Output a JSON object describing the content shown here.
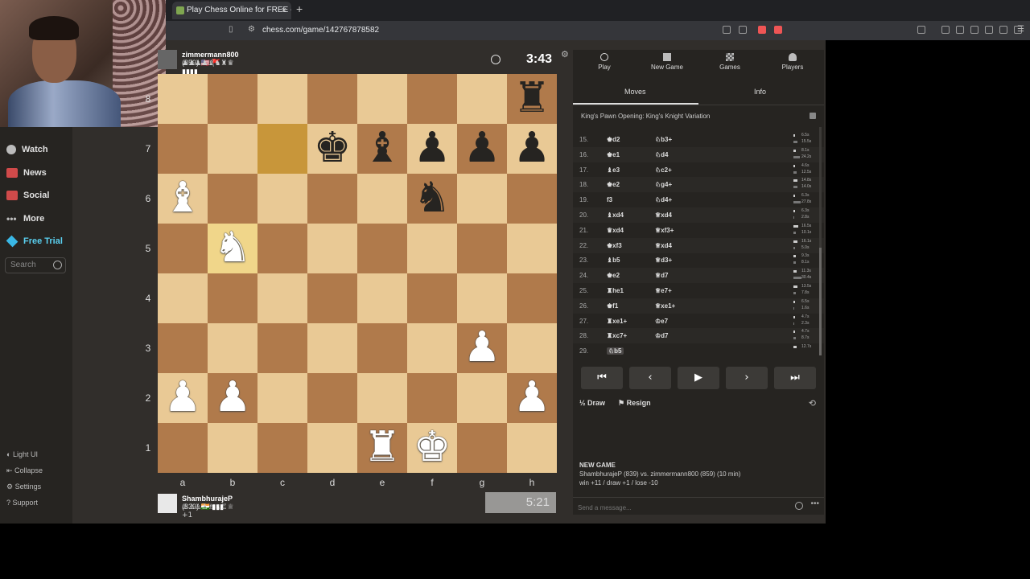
{
  "browser": {
    "tab_title": "Play Chess Online for FREE - ",
    "tab_close": "×",
    "new_tab": "+",
    "url": "chess.com/game/142767878582"
  },
  "sidebar": {
    "items": [
      {
        "label": "Watch",
        "icon": "watch-icon"
      },
      {
        "label": "News",
        "icon": "news-icon"
      },
      {
        "label": "Social",
        "icon": "social-icon"
      },
      {
        "label": "More",
        "icon": "more-icon"
      },
      {
        "label": "Free Trial",
        "icon": "diamond-icon"
      }
    ],
    "search_placeholder": "Search",
    "footer": [
      {
        "label": "Light UI",
        "icon": "light-icon"
      },
      {
        "label": "Collapse",
        "icon": "collapse-icon"
      },
      {
        "label": "Settings",
        "icon": "gear-icon"
      },
      {
        "label": "Support",
        "icon": "support-icon"
      }
    ]
  },
  "top_player": {
    "name": "zimmermann800",
    "rating": "(859)",
    "flags": "🇺🇸 🚩 ▮▮▮▮",
    "captured": "♟♟♟♟♝♞♜♛",
    "clock": "3:43"
  },
  "bottom_player": {
    "name": "ShambhurajeP",
    "rating": "(839)",
    "flags": "🇮🇳 ▮▮▮",
    "captured": "♙♙♙♙♗♘♖♕",
    "advantage": "+1",
    "clock": "5:21"
  },
  "board": {
    "ranks": [
      "8",
      "7",
      "6",
      "5",
      "4",
      "3",
      "2",
      "1"
    ],
    "files": [
      "a",
      "b",
      "c",
      "d",
      "e",
      "f",
      "g",
      "h"
    ],
    "position": [
      [
        "",
        "",
        "",
        "",
        "",
        "",
        "",
        "bR"
      ],
      [
        "",
        "",
        "",
        "bK",
        "bB",
        "bP",
        "bP",
        "bP"
      ],
      [
        "wB",
        "",
        "",
        "",
        "",
        "bN",
        "",
        ""
      ],
      [
        "",
        "wN",
        "",
        "",
        "",
        "",
        "",
        ""
      ],
      [
        "",
        "",
        "",
        "",
        "",
        "",
        "",
        ""
      ],
      [
        "",
        "",
        "",
        "",
        "",
        "",
        "wP",
        ""
      ],
      [
        "wP",
        "wP",
        "",
        "",
        "",
        "",
        "",
        "wP"
      ],
      [
        "",
        "",
        "",
        "",
        "wR",
        "wK",
        "",
        ""
      ]
    ],
    "highlights": [
      "c7",
      "b5"
    ]
  },
  "panel": {
    "tabs": [
      {
        "label": "Play",
        "icon": "clock-icon"
      },
      {
        "label": "New Game",
        "icon": "plus-icon"
      },
      {
        "label": "Games",
        "icon": "board-icon"
      },
      {
        "label": "Players",
        "icon": "players-icon"
      }
    ],
    "subtabs": {
      "moves": "Moves",
      "info": "Info"
    },
    "opening": "King's Pawn Opening: King's Knight Variation",
    "moves": [
      {
        "n": "15.",
        "w": "♚d2",
        "b": "♘b3+",
        "tw": "6.5s",
        "tb": "15.5s"
      },
      {
        "n": "16.",
        "w": "♚e1",
        "b": "♘d4",
        "tw": "8.1s",
        "tb": "24.2s"
      },
      {
        "n": "17.",
        "w": "♝e3",
        "b": "♘c2+",
        "tw": "4.6s",
        "tb": "12.5s"
      },
      {
        "n": "18.",
        "w": "♚e2",
        "b": "♘g4+",
        "tw": "14.8s",
        "tb": "14.0s"
      },
      {
        "n": "19.",
        "w": "f3",
        "b": "♘d4+",
        "tw": "6.3s",
        "tb": "27.8s"
      },
      {
        "n": "20.",
        "w": "♝xd4",
        "b": "♕xd4",
        "tw": "6.3s",
        "tb": "2.8s"
      },
      {
        "n": "21.",
        "w": "♛xd4",
        "b": "♕xf3+",
        "tw": "16.5s",
        "tb": "10.1s"
      },
      {
        "n": "22.",
        "w": "♚xf3",
        "b": "♕xd4",
        "tw": "16.1s",
        "tb": "5.0s"
      },
      {
        "n": "23.",
        "w": "♝b5",
        "b": "♕d3+",
        "tw": "9.3s",
        "tb": "8.1s"
      },
      {
        "n": "24.",
        "w": "♚e2",
        "b": "♕d7",
        "tw": "11.3s",
        "tb": "30.4s"
      },
      {
        "n": "25.",
        "w": "♜he1",
        "b": "♕e7+",
        "tw": "13.5s",
        "tb": "7.8s"
      },
      {
        "n": "26.",
        "w": "♚f1",
        "b": "♕xe1+",
        "tw": "6.5s",
        "tb": "1.6s"
      },
      {
        "n": "27.",
        "w": "♜xe1+",
        "b": "♔e7",
        "tw": "4.7s",
        "tb": "2.3s"
      },
      {
        "n": "28.",
        "w": "♜xc7+",
        "b": "♔d7",
        "tw": "4.7s",
        "tb": "8.7s"
      },
      {
        "n": "29.",
        "w": "♘b5",
        "b": "",
        "tw": "12.7s",
        "tb": ""
      }
    ],
    "nav": [
      "⏮",
      "‹",
      "▶",
      "›",
      "⏭"
    ],
    "draw": "Draw",
    "resign": "Resign",
    "flip": "⟲",
    "new_game_title": "NEW GAME",
    "new_game_line1": "ShambhurajeP (839) vs. zimmermann800 (859) (10 min)",
    "new_game_line2": "win +11 / draw +1 / lose -10",
    "message_placeholder": "Send a message..."
  }
}
